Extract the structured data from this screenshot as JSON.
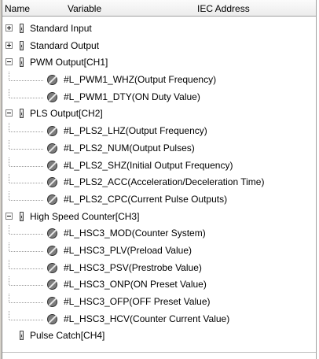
{
  "header": {
    "col_name": "Name",
    "col_variable": "Variable",
    "col_iec": "IEC Address"
  },
  "tree": {
    "standard_input": {
      "label": "Standard Input",
      "expanded": false
    },
    "standard_output": {
      "label": "Standard Output",
      "expanded": false
    },
    "pwm_output": {
      "label": "PWM Output[CH1]",
      "expanded": true,
      "items": [
        "#L_PWM1_WHZ(Output Frequency)",
        "#L_PWM1_DTY(ON Duty Value)"
      ]
    },
    "pls_output": {
      "label": "PLS Output[CH2]",
      "expanded": true,
      "items": [
        "#L_PLS2_LHZ(Output Frequency)",
        "#L_PLS2_NUM(Output Pulses)",
        "#L_PLS2_SHZ(Initial Output Frequency)",
        "#L_PLS2_ACC(Acceleration/Deceleration  Time)",
        "#L_PLS2_CPC(Current Pulse Outputs)"
      ]
    },
    "hsc": {
      "label": "High Speed Counter[CH3]",
      "expanded": true,
      "items": [
        "#L_HSC3_MOD(Counter System)",
        "#L_HSC3_PLV(Preload Value)",
        "#L_HSC3_PSV(Prestrobe Value)",
        "#L_HSC3_ONP(ON Preset Value)",
        "#L_HSC3_OFP(OFF Preset Value)",
        "#L_HSC3_HCV(Counter Current Value)"
      ]
    },
    "pulse_catch": {
      "label": "Pulse Catch[CH4]"
    }
  }
}
